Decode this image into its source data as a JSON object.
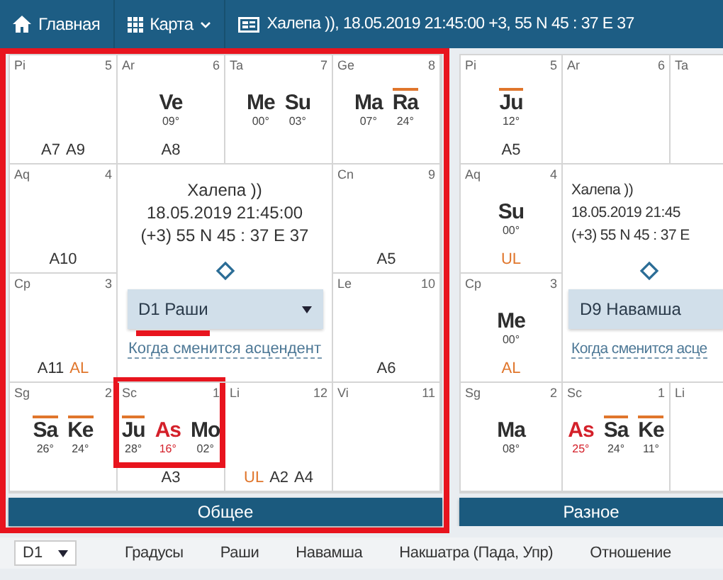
{
  "nav": [
    {
      "label": "Главная",
      "caret": false
    },
    {
      "label": "Карта",
      "caret": true
    },
    {
      "label": "Халепа )), 18.05.2019 21:45:00 +3, 55 N 45 : 37 E 37",
      "caret": false
    }
  ],
  "charts": [
    {
      "highlighted": true,
      "button": "Общее",
      "cells": [
        {
          "sign": "Pi",
          "number": "5",
          "highlighted": false,
          "labels": [
            {
              "text": "A7",
              "special": false
            },
            {
              "text": "A9",
              "special": false
            }
          ]
        },
        {
          "sign": "Ar",
          "number": "6",
          "highlighted": false,
          "planets": [
            {
              "name": "Ve",
              "degree": "09°",
              "kind": "planet",
              "retrograde": false
            }
          ],
          "labels": [
            {
              "text": "A8",
              "special": false
            }
          ]
        },
        {
          "sign": "Ta",
          "number": "7",
          "highlighted": false,
          "planets": [
            {
              "name": "Me",
              "degree": "00°",
              "kind": "planet",
              "retrograde": false
            },
            {
              "name": "Su",
              "degree": "03°",
              "kind": "planet",
              "retrograde": false
            }
          ]
        },
        {
          "sign": "Ge",
          "number": "8",
          "highlighted": false,
          "planets": [
            {
              "name": "Ma",
              "degree": "07°",
              "kind": "planet",
              "retrograde": false
            },
            {
              "name": "Ra",
              "degree": "24°",
              "kind": "planet",
              "retrograde": true
            }
          ]
        },
        {
          "sign": "Aq",
          "number": "4",
          "highlighted": false,
          "labels": [
            {
              "text": "A10",
              "special": false
            }
          ]
        },
        {
          "sign": "Cn",
          "number": "9",
          "highlighted": false,
          "labels": [
            {
              "text": "A5",
              "special": false
            }
          ]
        },
        {
          "sign": "Cp",
          "number": "3",
          "highlighted": false,
          "labels": [
            {
              "text": "A11",
              "special": false
            },
            {
              "text": "AL",
              "special": true
            }
          ]
        },
        {
          "sign": "Le",
          "number": "10",
          "highlighted": false,
          "labels": [
            {
              "text": "A6",
              "special": false
            }
          ]
        },
        {
          "sign": "Sg",
          "number": "2",
          "highlighted": false,
          "planets": [
            {
              "name": "Sa",
              "degree": "26°",
              "kind": "planet",
              "retrograde": true
            },
            {
              "name": "Ke",
              "degree": "24°",
              "kind": "planet",
              "retrograde": true
            }
          ]
        },
        {
          "sign": "Sc",
          "number": "1",
          "highlighted": true,
          "planets": [
            {
              "name": "Ju",
              "degree": "28°",
              "kind": "planet",
              "retrograde": true
            },
            {
              "name": "As",
              "degree": "16°",
              "kind": "ascendant",
              "retrograde": false
            },
            {
              "name": "Mo",
              "degree": "02°",
              "kind": "planet",
              "retrograde": false
            }
          ],
          "labels": [
            {
              "text": "A3",
              "special": false
            }
          ]
        },
        {
          "sign": "Li",
          "number": "12",
          "highlighted": false,
          "labels": [
            {
              "text": "UL",
              "special": true
            },
            {
              "text": "A2",
              "special": false
            },
            {
              "text": "A4",
              "special": false
            }
          ]
        },
        {
          "sign": "Vi",
          "number": "11",
          "highlighted": false
        }
      ],
      "center": {
        "lines": [
          "Халепа ))",
          "18.05.2019 21:45:00",
          "(+3) 55 N 45 : 37 E 37"
        ],
        "dropdown": "D1 Раши",
        "underlined": true,
        "link": "Когда сменится асцендент"
      }
    },
    {
      "highlighted": false,
      "button": "Разное",
      "cells": [
        {
          "sign": "Pi",
          "number": "5",
          "highlighted": false,
          "planets": [
            {
              "name": "Ju",
              "degree": "12°",
              "kind": "planet",
              "retrograde": true
            }
          ],
          "labels": [
            {
              "text": "A5",
              "special": false
            }
          ]
        },
        {
          "sign": "Ar",
          "number": "6",
          "highlighted": false
        },
        {
          "sign": "Ta",
          "highlighted": false
        },
        {
          "sign": "Aq",
          "number": "4",
          "highlighted": false,
          "planets": [
            {
              "name": "Su",
              "degree": "00°",
              "kind": "planet",
              "retrograde": false
            }
          ],
          "labels": [
            {
              "text": "UL",
              "special": true
            }
          ]
        },
        {
          "sign": "Cp",
          "number": "3",
          "highlighted": false,
          "planets": [
            {
              "name": "Me",
              "degree": "00°",
              "kind": "planet",
              "retrograde": false
            }
          ],
          "labels": [
            {
              "text": "AL",
              "special": true
            }
          ]
        },
        {
          "sign": "Sg",
          "number": "2",
          "highlighted": false,
          "planets": [
            {
              "name": "Ma",
              "degree": "08°",
              "kind": "planet",
              "retrograde": false
            }
          ]
        },
        {
          "sign": "Sc",
          "number": "1",
          "highlighted": false,
          "planets": [
            {
              "name": "As",
              "degree": "25°",
              "kind": "ascendant",
              "retrograde": false
            },
            {
              "name": "Sa",
              "degree": "24°",
              "kind": "planet",
              "retrograde": true
            },
            {
              "name": "Ke",
              "degree": "11°",
              "kind": "planet",
              "retrograde": true
            }
          ]
        },
        {
          "sign": "Li",
          "highlighted": false
        }
      ],
      "center": {
        "lines": [
          "Халепа ))",
          "18.05.2019 21:45",
          "(+3) 55 N 45 : 37 E"
        ],
        "dropdown": "D9 Навамша",
        "underlined": false,
        "link": "Когда сменится асце"
      }
    }
  ],
  "table": {
    "division": "D1",
    "columns": [
      "Градусы",
      "Раши",
      "Навамша",
      "Накшатра (Пада, Упр)",
      "Отношение"
    ]
  }
}
